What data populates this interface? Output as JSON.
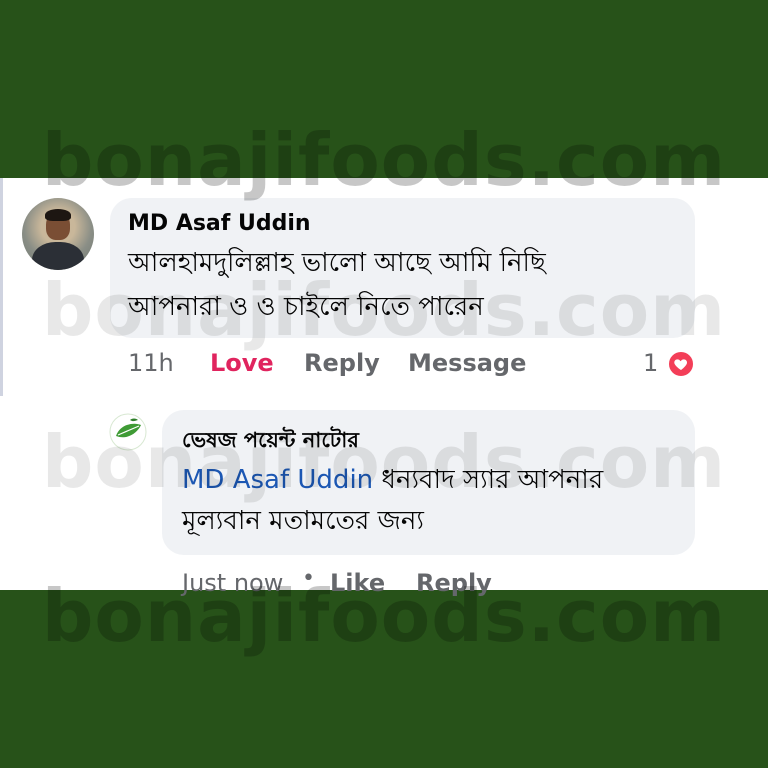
{
  "comment": {
    "author": "MD Asaf Uddin",
    "text_line1": "আলহামদুলিল্লাহ ভালো আছে আমি নিছি",
    "text_line2": "আপনারা ও ও চাইলে নিতে পারেন",
    "time": "11h",
    "reaction_label": "Love",
    "reply_label": "Reply",
    "message_label": "Message",
    "reaction_count": "1"
  },
  "reply": {
    "author": "ভেষজ পয়েন্ট নাটোর",
    "mention": "MD Asaf Uddin",
    "text_line1": " ধন্যবাদ স্যার আপনার",
    "text_line2": "মূল্যবান মতামতের জন্য",
    "time": "Just now",
    "separator": "•",
    "like_label": "Like",
    "reply_label": "Reply"
  },
  "watermark": "bonajifoods.com",
  "colors": {
    "frame": "#275219",
    "love": "#e0245e",
    "heart_badge": "#f33e58",
    "mention": "#1c57b3",
    "bubble": "#f0f2f5"
  }
}
